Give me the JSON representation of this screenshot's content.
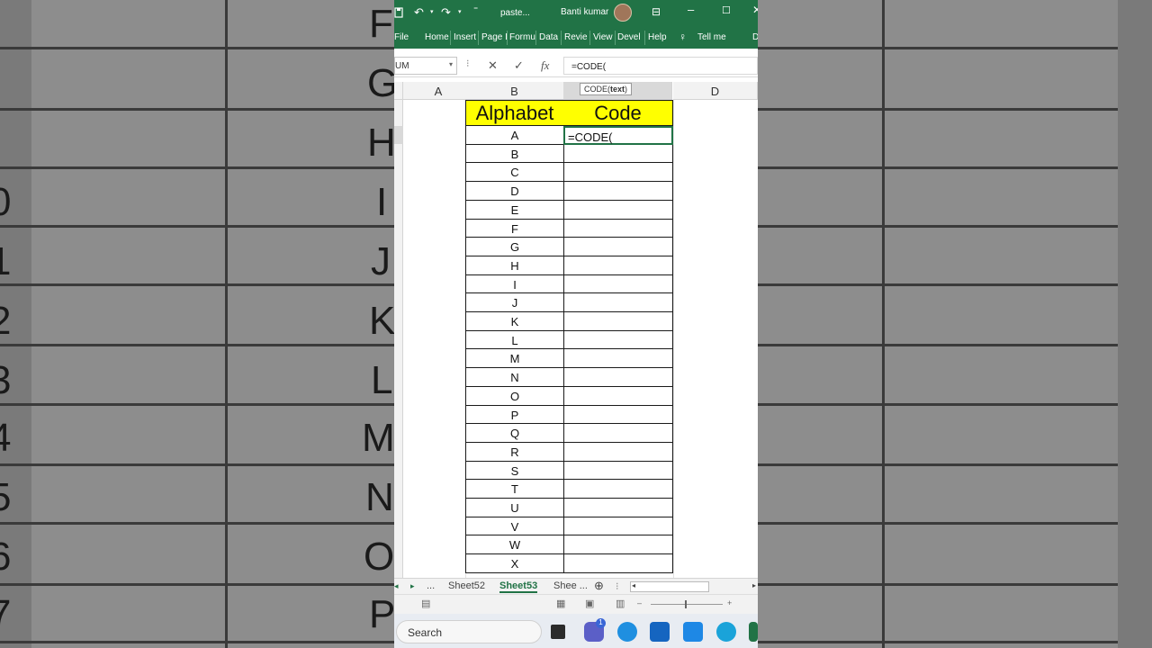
{
  "background": {
    "left_letters": [
      "F",
      "G",
      "H",
      "I",
      "J",
      "K",
      "L",
      "M",
      "N",
      "O",
      "P"
    ],
    "left_numbers": [
      "0",
      "1",
      "2",
      "3",
      "4",
      "5",
      "6",
      "7"
    ]
  },
  "titlebar": {
    "filename": "paste...",
    "user": "Banti kumar"
  },
  "ribbon": {
    "tabs": [
      "File",
      "Home",
      "Insert",
      "Page I",
      "Formu",
      "Data",
      "Revie",
      "View",
      "Devel",
      "Help"
    ],
    "tell_me": "Tell me"
  },
  "formula_bar": {
    "name_box": "UM",
    "fx": "fx",
    "formula": "=CODE("
  },
  "tooltip": {
    "fn": "CODE(",
    "arg": "text",
    "close": ")"
  },
  "columns": [
    "A",
    "B",
    "C",
    "D"
  ],
  "table": {
    "header_b": "Alphabet",
    "header_c": "Code",
    "active_cell_value": "=CODE(",
    "letters": [
      "A",
      "B",
      "C",
      "D",
      "E",
      "F",
      "G",
      "H",
      "I",
      "J",
      "K",
      "L",
      "M",
      "N",
      "O",
      "P",
      "Q",
      "R",
      "S",
      "T",
      "U",
      "V",
      "W",
      "X"
    ]
  },
  "sheets": {
    "nav_more": "...",
    "tabs": [
      "Sheet52",
      "Sheet53",
      "Shee ..."
    ],
    "active": "Sheet53"
  },
  "taskbar": {
    "search_label": "Search",
    "badge_count": "1"
  },
  "colors": {
    "excel_green": "#217346",
    "header_yellow": "#ffff00"
  }
}
